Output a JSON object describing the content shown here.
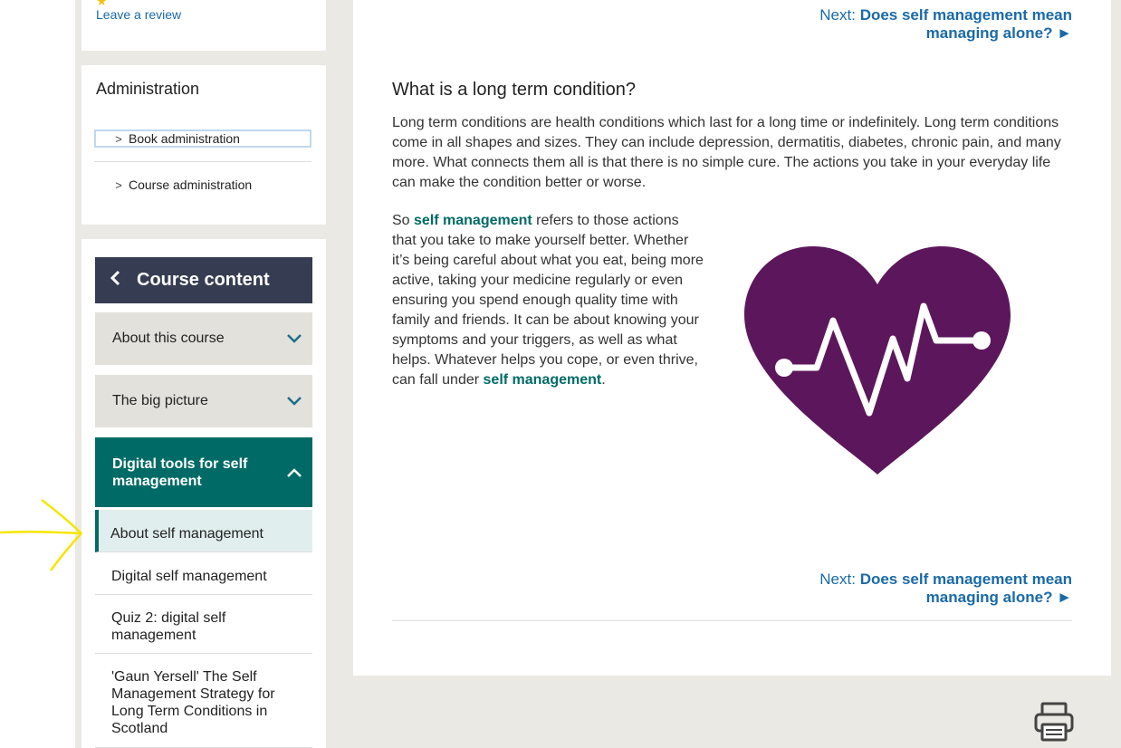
{
  "review": {
    "link": "Leave a review"
  },
  "admin": {
    "title": "Administration",
    "items": [
      {
        "label": "Book administration"
      },
      {
        "label": "Course administration"
      }
    ]
  },
  "nav": {
    "header": "Course content",
    "sections": [
      {
        "label": "About this course"
      },
      {
        "label": "The big picture"
      },
      {
        "label": "Digital tools for self management"
      }
    ],
    "subitems": [
      {
        "label": "About self management"
      },
      {
        "label": "Digital self management"
      },
      {
        "label": "Quiz 2: digital self management"
      },
      {
        "label": "'Gaun Yersell' The Self Management Strategy for Long Term Conditions in Scotland"
      }
    ]
  },
  "main": {
    "next_prefix": "Next:",
    "next_title_line1": "Does self management mean",
    "next_title_line2": "managing alone? ►",
    "heading": "What is a long term condition?",
    "para1": "Long term conditions are health conditions which last for a long time or indefinitely. Long term conditions come in all shapes and sizes. They can include depression, dermatitis, diabetes, chronic pain, and many more. What connects them all is that there is no simple cure. The actions you take in your everyday life can make the condition better or worse.",
    "para2_a": "So ",
    "para2_b": "self management",
    "para2_c": " refers to those actions that you take to make yourself better. Whether it’s being careful about what you eat, being more active, taking your medicine regularly or even ensuring you spend enough quality time with family and friends. It can be about knowing your symptoms and your triggers, as well as what helps. Whatever helps you cope, or even thrive, can fall under ",
    "para2_d": "self management",
    "para2_e": "."
  },
  "colors": {
    "accent_teal": "#006b66",
    "nav_header": "#363c52",
    "link_blue": "#1a6aa8",
    "heart_purple": "#5c175c",
    "annotation_yellow": "#f5e600"
  }
}
